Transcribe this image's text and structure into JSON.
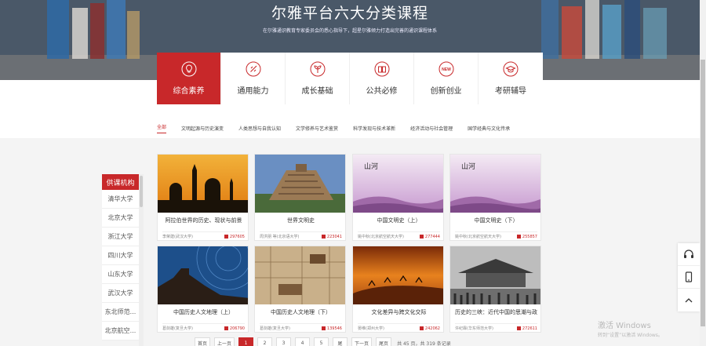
{
  "banner": {
    "title": "尔雅平台六大分类课程",
    "subtitle": "在尔雅通识教育专家委员会的悉心指导下，超星尔雅倾力打造出完善的通识课程体系"
  },
  "tabs": [
    {
      "label": "综合素养",
      "icon": "lightbulb-icon",
      "active": true
    },
    {
      "label": "通用能力",
      "icon": "rocket-icon",
      "active": false
    },
    {
      "label": "成长基础",
      "icon": "sprout-icon",
      "active": false
    },
    {
      "label": "公共必修",
      "icon": "book-icon",
      "active": false
    },
    {
      "label": "创新创业",
      "icon": "new-badge-icon",
      "badge": "NEW",
      "active": false
    },
    {
      "label": "考研辅导",
      "icon": "graduation-cap-icon",
      "active": false
    }
  ],
  "subnav": [
    "全部",
    "文明起源与历史演变",
    "人类思想与自我认知",
    "文学修养与艺术鉴赏",
    "科学发现与技术革新",
    "经济活动与社会管理",
    "国学经典与文化传承"
  ],
  "sidebar": {
    "header": "供课机构",
    "items": [
      "清华大学",
      "北京大学",
      "浙江大学",
      "四川大学",
      "山东大学",
      "武汉大学",
      "东北师范...",
      "北京航空..."
    ]
  },
  "cards": [
    {
      "title": "阿拉伯世界的历史、现状与前景",
      "teacher": "李荣建(武汉大学)",
      "count": "297605"
    },
    {
      "title": "世界文明史",
      "teacher": "周洪朋 等(北京语大学)",
      "count": "223041"
    },
    {
      "title": "中国文明史（上）",
      "teacher": "姚中秋(北京航空航天大学)",
      "count": "277444"
    },
    {
      "title": "中国文明史（下）",
      "teacher": "姚中秋(北京航空航天大学)",
      "count": "255857"
    },
    {
      "title": "中国历史人文地理（上）",
      "teacher": "葛剑雄(复旦大学)",
      "count": "206790"
    },
    {
      "title": "中国历史人文地理（下）",
      "teacher": "葛剑雄(复旦大学)",
      "count": "139546"
    },
    {
      "title": "文化差异与跨文化交际",
      "teacher": "晏维(郑州大学)",
      "count": "242062"
    },
    {
      "title": "历史的三峡：近代中国的思潮与政",
      "teacher": "许纪霖(华东师范大学)",
      "count": "272611"
    }
  ],
  "pager": {
    "first": "首页",
    "prev": "上一页",
    "pages": [
      "1",
      "2",
      "3",
      "4",
      "5"
    ],
    "current": "1",
    "last": "尾",
    "next": "下一页",
    "end": "尾页",
    "summary": "共 45 页，共 319 条记录"
  },
  "watermark": {
    "line1": "激活 Windows",
    "line2": "转到“设置”以激活 Windows。"
  },
  "colors": {
    "accent": "#c8282a"
  }
}
